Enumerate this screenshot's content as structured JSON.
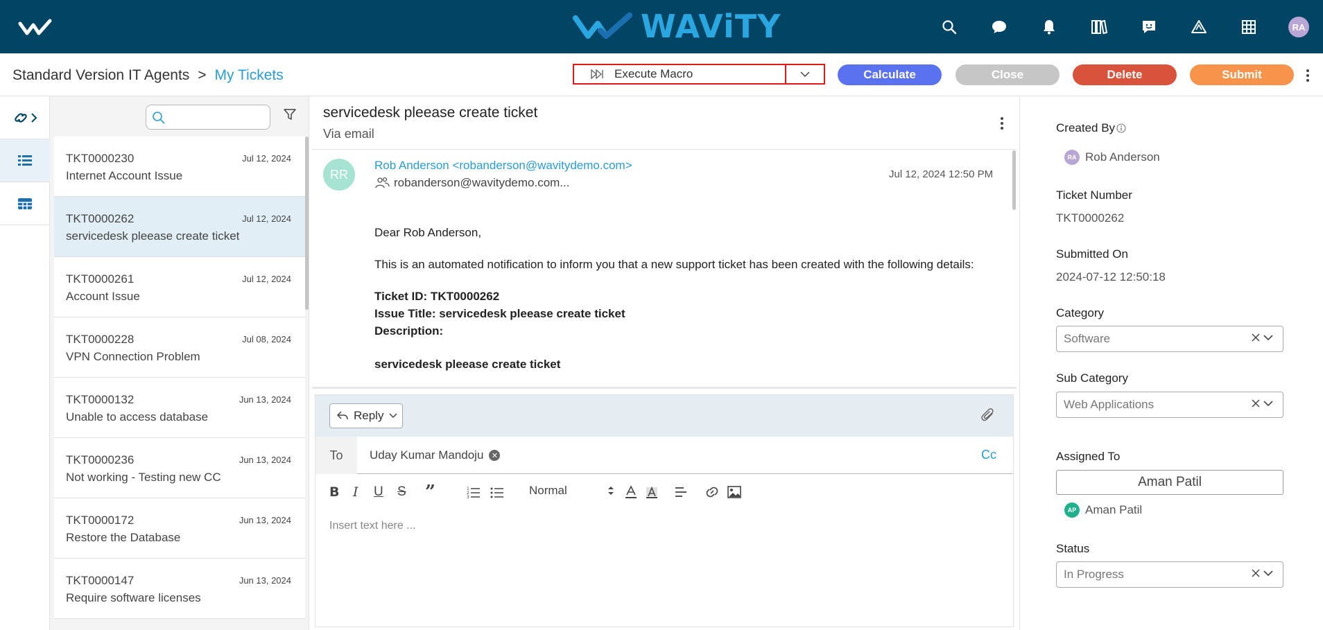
{
  "app": {
    "brand": "WAViTY",
    "user_initials": "RA"
  },
  "colors": {
    "topbar": "#014463",
    "accent": "#2a9bd4",
    "calculate": "#5a72f0",
    "close": "#c6c6c6",
    "delete": "#d9533c",
    "submit": "#f7934a",
    "highlight": "#e01919"
  },
  "top_icons": [
    "search-icon",
    "chat-icon",
    "bell-icon",
    "library-icon",
    "feedback-icon",
    "alert-triangle-icon",
    "grid-icon"
  ],
  "breadcrumb": {
    "root": "Standard Version IT Agents",
    "separator": ">",
    "current": "My Tickets"
  },
  "actions": {
    "macro_label": "Execute Macro",
    "calculate": "Calculate",
    "close": "Close",
    "delete": "Delete",
    "submit": "Submit"
  },
  "search": {
    "placeholder": ""
  },
  "tickets": [
    {
      "id": "TKT0000230",
      "date": "Jul 12, 2024",
      "title": "Internet Account Issue"
    },
    {
      "id": "TKT0000262",
      "date": "Jul 12, 2024",
      "title": "servicedesk pleease create ticket"
    },
    {
      "id": "TKT0000261",
      "date": "Jul 12, 2024",
      "title": "Account Issue"
    },
    {
      "id": "TKT0000228",
      "date": "Jul 08, 2024",
      "title": "VPN Connection Problem"
    },
    {
      "id": "TKT0000132",
      "date": "Jun 13, 2024",
      "title": "Unable to access database"
    },
    {
      "id": "TKT0000236",
      "date": "Jun 13, 2024",
      "title": "Not working - Testing new CC"
    },
    {
      "id": "TKT0000172",
      "date": "Jun 13, 2024",
      "title": "Restore the Database"
    },
    {
      "id": "TKT0000147",
      "date": "Jun 13, 2024",
      "title": "Require software licenses"
    }
  ],
  "message": {
    "subject": "servicedesk pleease create ticket",
    "via": "Via email",
    "sender_initials": "RR",
    "sender": "Rob Anderson <robanderson@wavitydemo.com>",
    "recipients": "robanderson@wavitydemo.com...",
    "time": "Jul 12, 2024 12:50 PM",
    "greeting": "Dear Rob Anderson,",
    "intro": "This is an automated notification to inform you that a new support ticket has been created with the following details:",
    "ticket_id_line": "Ticket ID: TKT0000262",
    "issue_title_line": "Issue Title: servicedesk pleease create ticket",
    "description_label": "Description:",
    "description": "servicedesk pleease create ticket"
  },
  "reply": {
    "mode": "Reply",
    "to_label": "To",
    "to_recipient": "Uday Kumar Mandoju",
    "cc": "Cc",
    "format": "Normal",
    "placeholder": "Insert text here ..."
  },
  "details": {
    "created_by_label": "Created By",
    "created_by": "Rob Anderson",
    "created_by_initials": "RA",
    "ticket_number_label": "Ticket Number",
    "ticket_number": "TKT0000262",
    "submitted_on_label": "Submitted On",
    "submitted_on": "2024-07-12 12:50:18",
    "category_label": "Category",
    "category": "Software",
    "sub_category_label": "Sub Category",
    "sub_category": "Web Applications",
    "assigned_to_label": "Assigned To",
    "assigned_to": "Aman Patil",
    "assignee_initials": "AP",
    "assignee": "Aman Patil",
    "status_label": "Status",
    "status": "In Progress"
  }
}
